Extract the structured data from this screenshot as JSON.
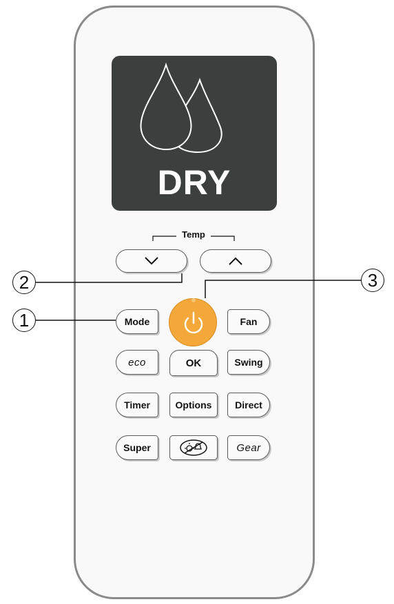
{
  "display": {
    "mode_text": "DRY",
    "icon": "water-drops-icon",
    "background_color": "#3b403e"
  },
  "temp": {
    "label": "Temp",
    "down_icon": "chevron-down-icon",
    "up_icon": "chevron-up-icon"
  },
  "buttons": {
    "mode": "Mode",
    "fan": "Fan",
    "eco": "eco",
    "ok": "OK",
    "swing": "Swing",
    "timer": "Timer",
    "options": "Options",
    "direct": "Direct",
    "super": "Super",
    "light_sound_icon": "light-and-sound-icon",
    "gear": "Gear"
  },
  "power": {
    "icon": "power-icon",
    "color": "#f4a83a"
  },
  "callouts": [
    "1",
    "2",
    "3"
  ]
}
